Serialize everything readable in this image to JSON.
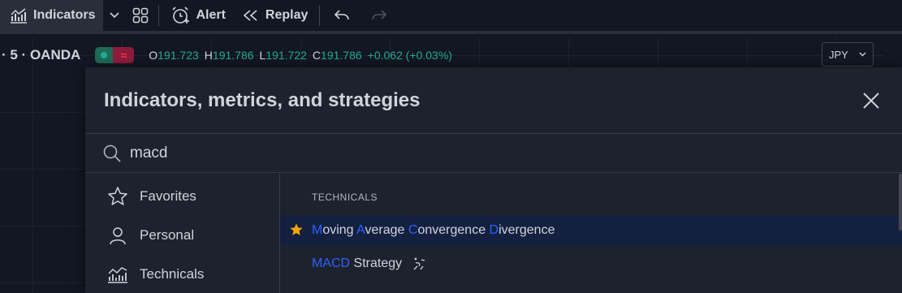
{
  "toolbar": {
    "indicators_label": "Indicators",
    "alert_label": "Alert",
    "replay_label": "Replay"
  },
  "legend": {
    "symbol_text": "· 5 · OANDA",
    "open_key": "O",
    "open_value": "191.723",
    "high_key": "H",
    "high_value": "191.786",
    "low_key": "L",
    "low_value": "191.722",
    "close_key": "C",
    "close_value": "191.786",
    "change": "+0.062 (+0.03%)"
  },
  "currency": {
    "value": "JPY"
  },
  "dialog": {
    "title": "Indicators, metrics, and strategies",
    "search_value": "macd",
    "sidebar": [
      {
        "label": "Favorites",
        "icon": "star-outline-icon"
      },
      {
        "label": "Personal",
        "icon": "person-icon"
      },
      {
        "label": "Technicals",
        "icon": "technicals-chart-icon"
      }
    ],
    "section_label": "TECHNICALS",
    "results": [
      {
        "parts": [
          {
            "t": "M",
            "hl": true
          },
          {
            "t": "oving ",
            "hl": false
          },
          {
            "t": "A",
            "hl": true
          },
          {
            "t": "verage ",
            "hl": false
          },
          {
            "t": "C",
            "hl": true
          },
          {
            "t": "onvergence ",
            "hl": false
          },
          {
            "t": "D",
            "hl": true
          },
          {
            "t": "ivergence",
            "hl": false
          }
        ],
        "favorite": true
      },
      {
        "parts": [
          {
            "t": "MACD",
            "hl": true
          },
          {
            "t": " Strategy",
            "hl": false
          }
        ],
        "favorite": false
      }
    ]
  },
  "colors": {
    "background": "#131722",
    "panel": "#1e222d",
    "accent_blue": "#2962ff",
    "positive_green": "#22ab94",
    "favorite_star": "#f7a600",
    "selected_row": "#142040"
  }
}
